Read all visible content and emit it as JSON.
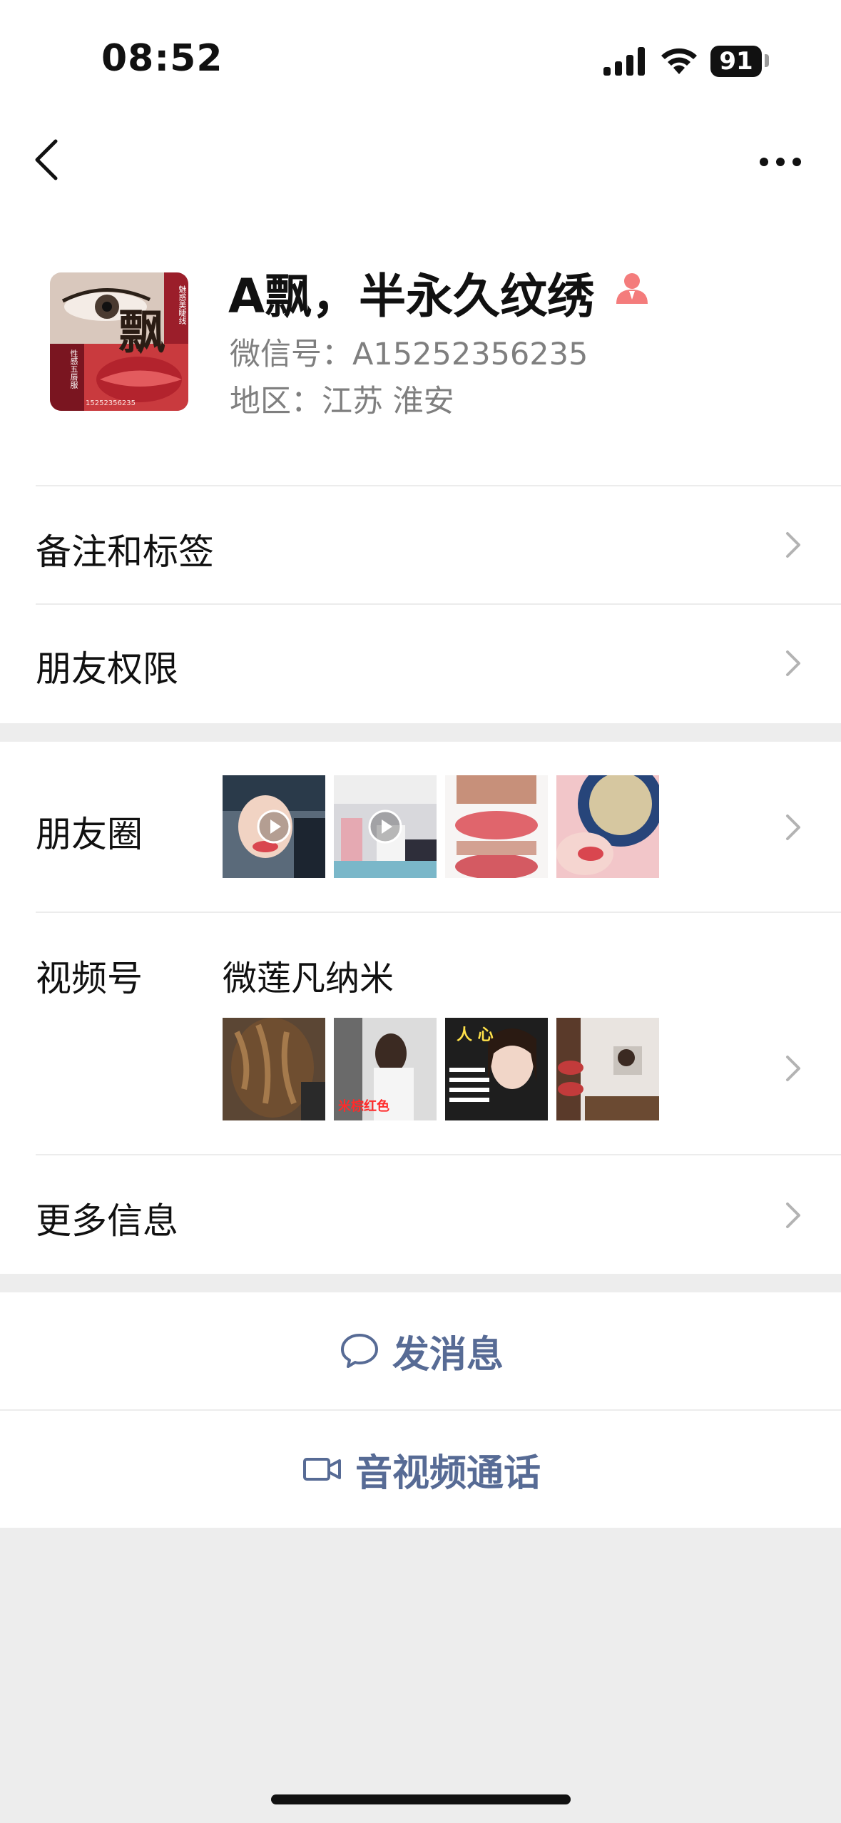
{
  "status_bar": {
    "time": "08:52",
    "battery": "91"
  },
  "profile": {
    "name": "A飘，半永久纹绣",
    "wechat_id": "微信号：A15252356235",
    "region": "地区：江苏 淮安",
    "avatar_text": {
      "big_char": "飘",
      "tag1": "魅惑美睫线",
      "tag2": "性感五唇服",
      "phone": "15252356235"
    }
  },
  "rows": {
    "remark": "备注和标签",
    "permission": "朋友权限",
    "moments": "朋友圈",
    "channels": "视频号",
    "channels_name": "微莲凡纳米",
    "more_info": "更多信息"
  },
  "channel_thumb_texts": {
    "t2": "米棕红色",
    "t3": "人 心"
  },
  "actions": {
    "message": "发消息",
    "call": "音视频通话"
  },
  "colors": {
    "accent": "#576b95",
    "background": "#ededed",
    "person_icon": "#f47c7c"
  }
}
